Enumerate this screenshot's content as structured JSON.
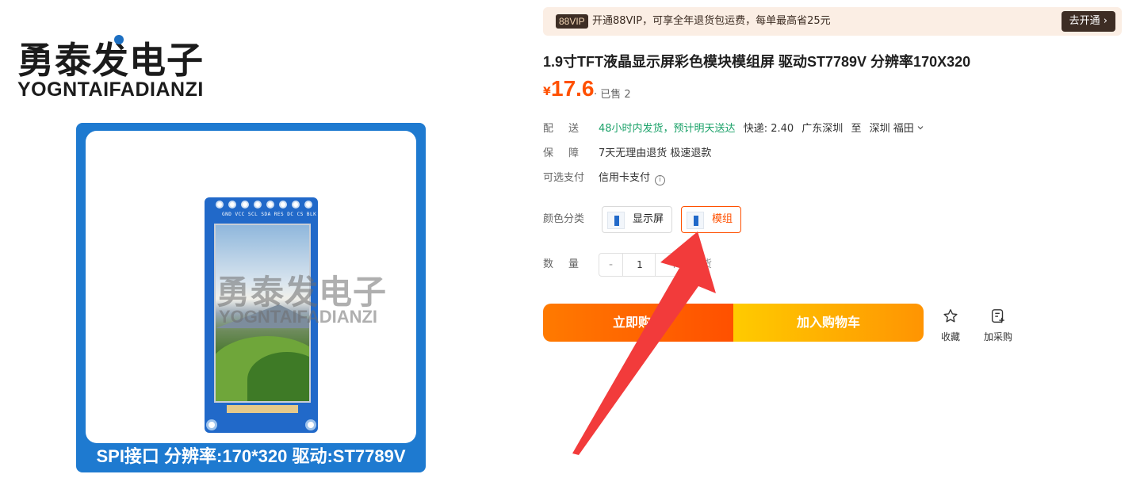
{
  "gallery": {
    "brand_cn": "勇泰发电子",
    "brand_en": "YOGNTAIFADIANZI",
    "pin_labels": "GND VCC SCL SDA RES DC CS BLK",
    "watermark_cn": "勇泰发电子",
    "watermark_en": "YOGNTAIFADIANZI",
    "caption": "SPI接口 分辨率:170*320 驱动:ST7789V"
  },
  "vip": {
    "badge": "88VIP",
    "text": "开通88VIP，可享全年退货包运费，每单最高省25元",
    "button": "去开通 ›"
  },
  "product": {
    "title": "1.9寸TFT液晶显示屏彩色模块模组屏 驱动ST7789V 分辨率170X320",
    "currency": "¥",
    "price": "17.6",
    "sold": "· 已售 2"
  },
  "delivery": {
    "label": "配送",
    "promise": "48小时内发货，预计明天送达",
    "fee": "快递: 2.40",
    "from": "广东深圳",
    "to_word": "至",
    "destination": "深圳 福田"
  },
  "guarantee": {
    "label": "保障",
    "value": "7天无理由退货 极速退款"
  },
  "payment": {
    "label": "可选支付",
    "value": "信用卡支付",
    "info_glyph": "i"
  },
  "sku": {
    "label": "颜色分类",
    "options": [
      {
        "label": "显示屏",
        "selected": false
      },
      {
        "label": "模组",
        "selected": true
      }
    ]
  },
  "quantity": {
    "label": "数量",
    "minus": "-",
    "value": "1",
    "plus": "+",
    "suffix": "货"
  },
  "actions": {
    "buy_now": "立即购买",
    "add_cart": "加入购物车",
    "favorite": "收藏",
    "add_purchase": "加采购"
  },
  "colors": {
    "price": "#ff5000",
    "green": "#1ca26a",
    "arrow": "#f23b3b",
    "frame_blue": "#1e7ad0"
  }
}
